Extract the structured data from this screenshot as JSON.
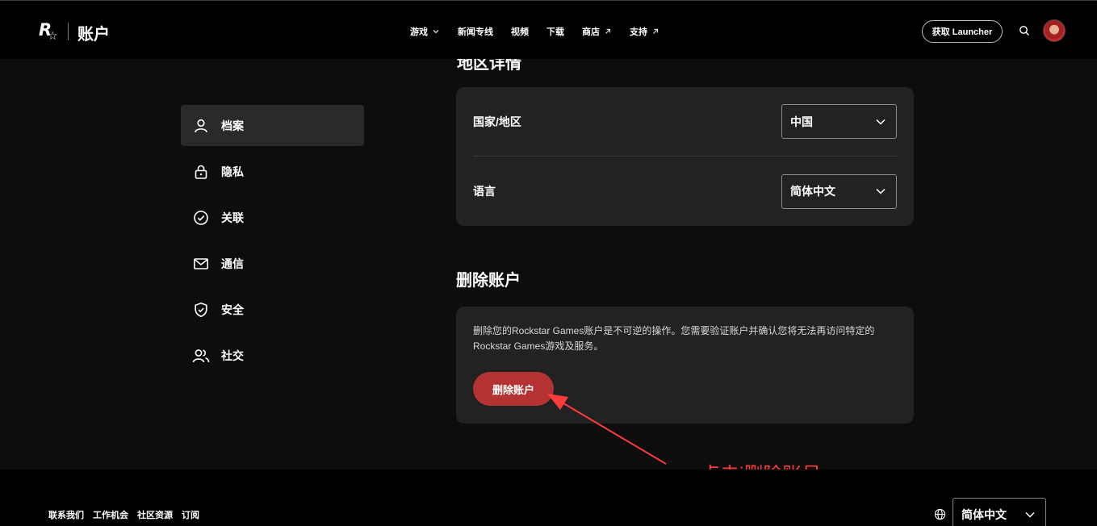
{
  "header": {
    "title": "账户",
    "nav": [
      {
        "label": "游戏",
        "icon": "chevron-down-icon"
      },
      {
        "label": "新闻专线",
        "icon": ""
      },
      {
        "label": "视频",
        "icon": ""
      },
      {
        "label": "下载",
        "icon": ""
      },
      {
        "label": "商店",
        "icon": "external-arrow-icon"
      },
      {
        "label": "支持",
        "icon": "external-arrow-icon"
      }
    ],
    "launcher_label": "获取 Launcher"
  },
  "sidebar": {
    "items": [
      {
        "label": "档案",
        "icon": "user-icon",
        "active": true
      },
      {
        "label": "隐私",
        "icon": "lock-icon"
      },
      {
        "label": "关联",
        "icon": "check-circle-icon"
      },
      {
        "label": "通信",
        "icon": "mail-icon"
      },
      {
        "label": "安全",
        "icon": "shield-icon"
      },
      {
        "label": "社交",
        "icon": "users-icon"
      }
    ]
  },
  "region": {
    "title": "地区详情",
    "country_label": "国家/地区",
    "country_value": "中国",
    "language_label": "语言",
    "language_value": "简体中文"
  },
  "delete": {
    "title": "删除账户",
    "description": "删除您的Rockstar Games账户是不可逆的操作。您需要验证账户并确认您将无法再访问特定的Rockstar Games游戏及服务。",
    "button_label": "删除账户"
  },
  "annotation": {
    "text": "点击i删除账号",
    "color": "#ff3b3b"
  },
  "footer": {
    "links": [
      "联系我们",
      "工作机会",
      "社区资源",
      "订阅"
    ],
    "language": "简体中文"
  },
  "colors": {
    "accent_red": "#b53232",
    "panel_bg": "#222222",
    "page_bg": "#0d0d0d"
  }
}
